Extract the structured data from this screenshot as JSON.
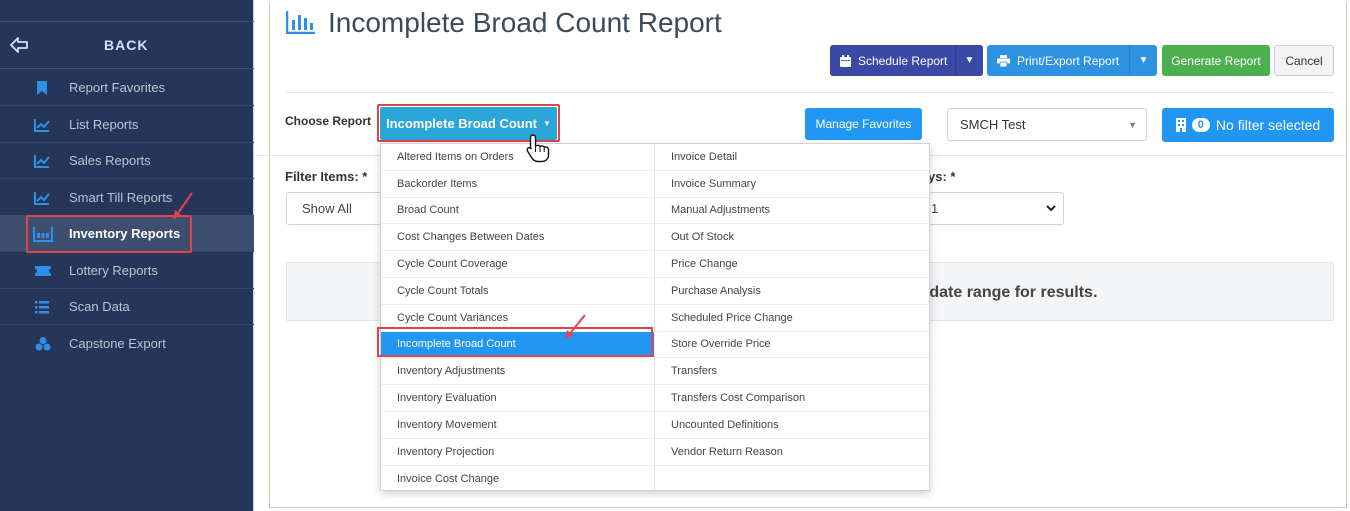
{
  "sidebar": {
    "back_label": "BACK",
    "items": [
      {
        "label": "Report Favorites",
        "icon": "bookmark-icon"
      },
      {
        "label": "List Reports",
        "icon": "trend-chart-icon"
      },
      {
        "label": "Sales Reports",
        "icon": "trend-chart-icon"
      },
      {
        "label": "Smart Till Reports",
        "icon": "trend-chart-icon"
      },
      {
        "label": "Inventory Reports",
        "icon": "inventory-icon",
        "active": true
      },
      {
        "label": "Lottery Reports",
        "icon": "ticket-icon"
      },
      {
        "label": "Scan Data",
        "icon": "list-icon"
      },
      {
        "label": "Capstone Export",
        "icon": "cubes-icon"
      }
    ]
  },
  "header": {
    "title": "Incomplete Broad Count Report",
    "schedule_label": "Schedule Report",
    "print_label": "Print/Export Report",
    "generate_label": "Generate Report",
    "cancel_label": "Cancel"
  },
  "controls": {
    "choose_label": "Choose Report",
    "report_selected": "Incomplete Broad Count",
    "manage_label": "Manage Favorites",
    "store_value": "SMCH Test",
    "filter_count": "0",
    "filter_label": "No filter selected",
    "filter_items_label": "Filter Items: *",
    "filter_items_value": "Show All",
    "days_label": "ys: *",
    "days_value": "1"
  },
  "results": {
    "message": "e date range for results."
  },
  "menu": {
    "left": [
      "Altered Items on Orders",
      "Backorder Items",
      "Broad Count",
      "Cost Changes Between Dates",
      "Cycle Count Coverage",
      "Cycle Count Totals",
      "Cycle Count Variances",
      "Incomplete Broad Count",
      "Inventory Adjustments",
      "Inventory Evaluation",
      "Inventory Movement",
      "Inventory Projection",
      "Invoice Cost Change"
    ],
    "right": [
      "Invoice Detail",
      "Invoice Summary",
      "Manual Adjustments",
      "Out Of Stock",
      "Price Change",
      "Purchase Analysis",
      "Scheduled Price Change",
      "Store Override Price",
      "Transfers",
      "Transfers Cost Comparison",
      "Uncounted Definitions",
      "Vendor Return Reason"
    ],
    "selected": "Incomplete Broad Count"
  },
  "colors": {
    "sidebar_bg": "#253659",
    "accent_blue": "#2196f3",
    "schedule_purple": "#3a48a6",
    "generate_green": "#4caf50",
    "highlight_red": "#e0444a"
  }
}
